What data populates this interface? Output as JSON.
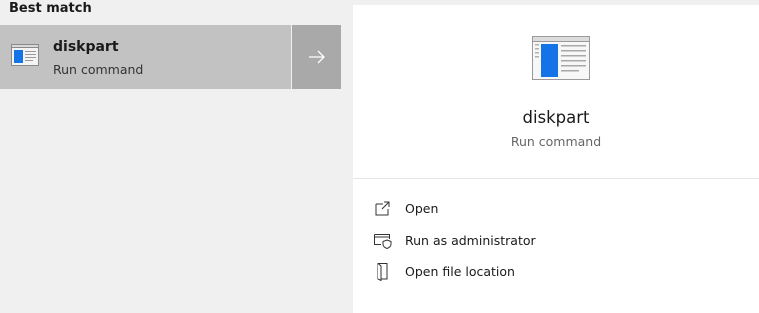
{
  "left": {
    "section_header": "Best match",
    "result": {
      "title": "diskpart",
      "subtitle": "Run command",
      "icon": "app-window-icon",
      "arrow_icon": "arrow-right-icon"
    }
  },
  "preview": {
    "title": "diskpart",
    "subtitle": "Run command",
    "icon": "app-window-icon",
    "actions": [
      {
        "label": "Open",
        "icon": "open-external-icon"
      },
      {
        "label": "Run as administrator",
        "icon": "shield-window-icon"
      },
      {
        "label": "Open file location",
        "icon": "file-location-icon"
      }
    ]
  },
  "colors": {
    "selected_bg": "#c2c2c2",
    "arrow_bg": "#a9a9a9",
    "pane_bg": "#f0f0f0",
    "preview_bg": "#ffffff",
    "icon_blue": "#1473e6"
  }
}
